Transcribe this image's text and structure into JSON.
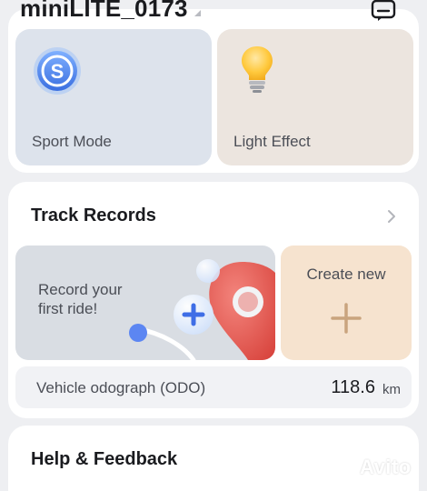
{
  "header": {
    "device_name": "miniLITE_0173",
    "chat_icon": "chat-bubble-icon"
  },
  "modes": [
    {
      "label": "Sport Mode",
      "icon": "sport-mode-icon"
    },
    {
      "label": "Light Effect",
      "icon": "light-bulb-icon"
    }
  ],
  "track_records": {
    "title": "Track Records",
    "record_prompt_line1": "Record your",
    "record_prompt_line2": "first ride!",
    "create_label": "Create new",
    "odo_label": "Vehicle odograph (ODO)",
    "odo_value": "118.6",
    "odo_unit": "km"
  },
  "help": {
    "title": "Help & Feedback"
  },
  "watermark": {
    "text": "Avito"
  },
  "colors": {
    "background": "#eeeff2",
    "sport_card": "#dde3ec",
    "light_card": "#ece5df",
    "create_card": "#f6e3cf",
    "accent_blue": "#4a7ef0",
    "pin_red": "#e0605a"
  }
}
